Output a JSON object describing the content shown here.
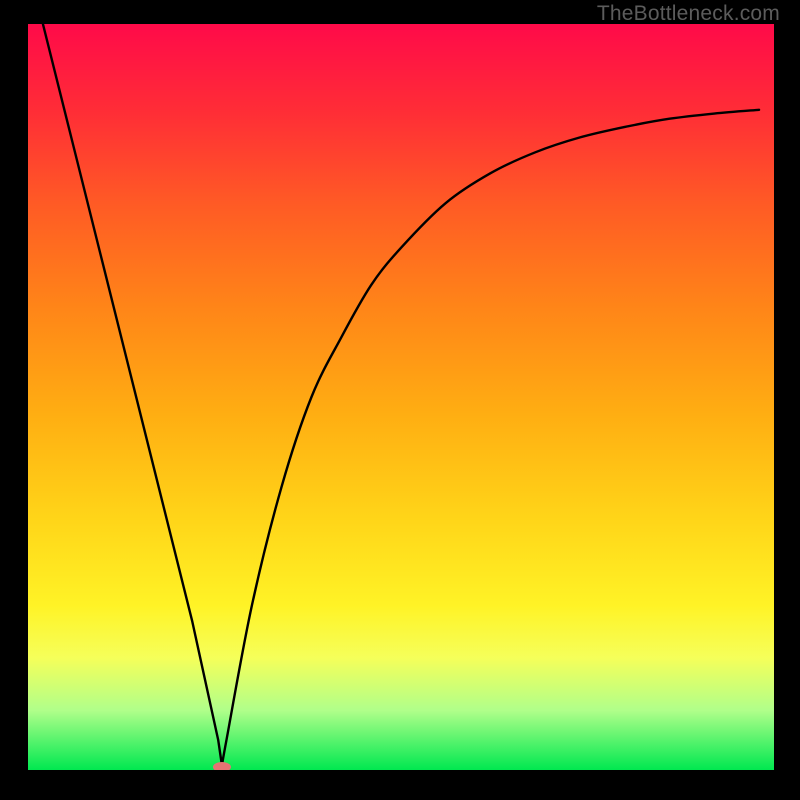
{
  "watermark": "TheBottleneck.com",
  "chart_data": {
    "type": "line",
    "title": "",
    "xlabel": "",
    "ylabel": "",
    "xlim": [
      0,
      1
    ],
    "ylim": [
      0,
      1
    ],
    "grid": false,
    "legend": false,
    "annotations": [],
    "series": [
      {
        "name": "curve",
        "color": "#000000",
        "x": [
          0.02,
          0.06,
          0.1,
          0.14,
          0.18,
          0.22,
          0.255,
          0.26,
          0.266,
          0.3,
          0.34,
          0.38,
          0.42,
          0.46,
          0.5,
          0.56,
          0.62,
          0.68,
          0.74,
          0.8,
          0.86,
          0.92,
          0.98
        ],
        "y": [
          1.0,
          0.84,
          0.68,
          0.52,
          0.36,
          0.2,
          0.04,
          0.006,
          0.04,
          0.22,
          0.38,
          0.5,
          0.58,
          0.65,
          0.7,
          0.76,
          0.8,
          0.828,
          0.848,
          0.862,
          0.873,
          0.88,
          0.885
        ]
      }
    ],
    "marker": {
      "name": "min-point",
      "x": 0.26,
      "y": 0.004,
      "color": "#e57373"
    }
  }
}
